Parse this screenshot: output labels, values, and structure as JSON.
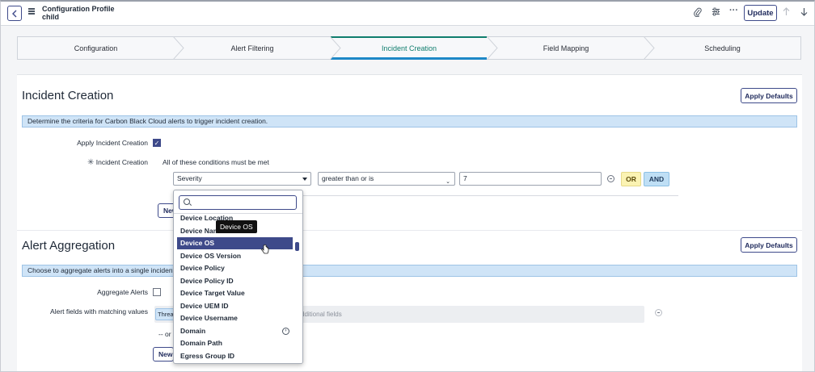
{
  "header": {
    "title_line1": "Configuration Profile",
    "title_line2": "child",
    "update_label": "Update",
    "icons": [
      "back-icon",
      "menu-icon",
      "paperclip-icon",
      "settings-sliders-icon",
      "more-icon",
      "arrow-up-icon",
      "arrow-down-icon"
    ]
  },
  "steps": [
    {
      "label": "Configuration",
      "active": false
    },
    {
      "label": "Alert Filtering",
      "active": false
    },
    {
      "label": "Incident Creation",
      "active": true
    },
    {
      "label": "Field Mapping",
      "active": false
    },
    {
      "label": "Scheduling",
      "active": false
    }
  ],
  "incident": {
    "title": "Incident Creation",
    "apply_defaults": "Apply Defaults",
    "info": "Determine the criteria for Carbon Black Cloud alerts to trigger incident creation.",
    "apply_label": "Apply Incident Creation",
    "apply_checked": true,
    "condition_label": "Incident Creation",
    "condition_text": "All of these conditions must be met",
    "field_value": "Severity",
    "operator_value": "greater than or is",
    "value_value": "7",
    "or_label": "OR",
    "and_label": "AND",
    "new_label": "New"
  },
  "dropdown": {
    "search_value": "",
    "items": [
      {
        "label": "Device Location",
        "selected": false
      },
      {
        "label": "Device Name",
        "selected": false
      },
      {
        "label": "Device OS",
        "selected": true
      },
      {
        "label": "Device OS Version",
        "selected": false
      },
      {
        "label": "Device Policy",
        "selected": false
      },
      {
        "label": "Device Policy ID",
        "selected": false
      },
      {
        "label": "Device Target Value",
        "selected": false
      },
      {
        "label": "Device UEM ID",
        "selected": false
      },
      {
        "label": "Device Username",
        "selected": false
      },
      {
        "label": "Domain",
        "selected": false,
        "expandable": true
      },
      {
        "label": "Domain Path",
        "selected": false
      },
      {
        "label": "Egress Group ID",
        "selected": false
      }
    ],
    "tooltip": "Device OS"
  },
  "aggregation": {
    "title": "Alert Aggregation",
    "apply_defaults": "Apply Defaults",
    "info": "Choose to aggregate alerts into a single incident w",
    "aggregate_label": "Aggregate Alerts",
    "aggregate_checked": false,
    "match_label": "Alert fields with matching values",
    "chip_text": "Threa",
    "fields_placeholder": "dditional fields",
    "or_text": "-- or --",
    "new_label": "New"
  }
}
